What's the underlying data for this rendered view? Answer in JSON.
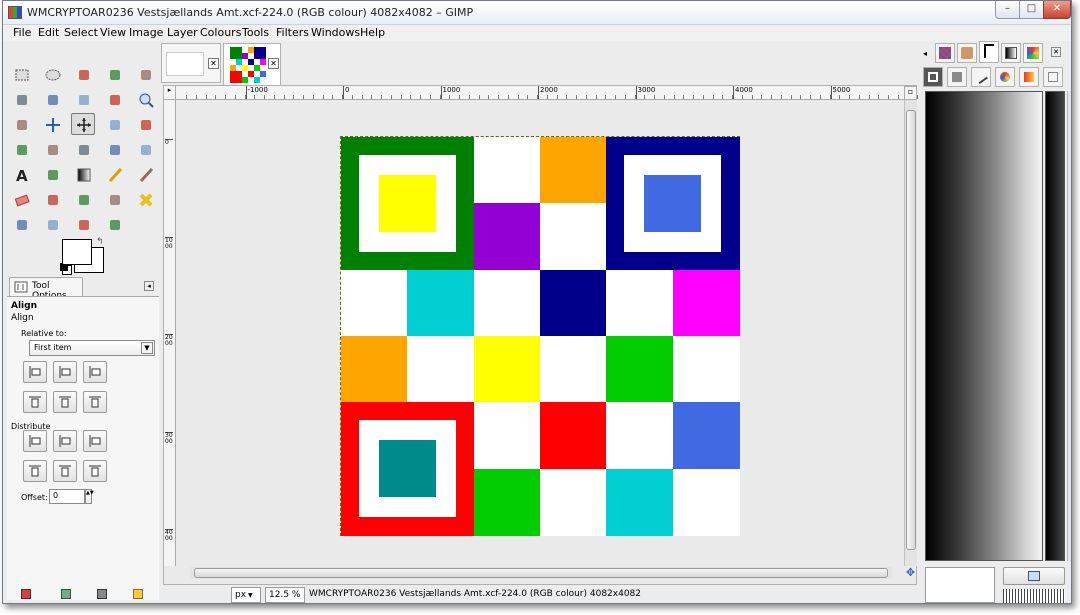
{
  "window": {
    "title": "WMCRYPTOAR0236 Vestsjællands Amt.xcf-224.0 (RGB colour) 4082x4082 – GIMP",
    "minimize": "–",
    "maximize": "□",
    "close": "✕"
  },
  "menubar": [
    "File",
    "Edit",
    "Select",
    "View",
    "Image",
    "Layer",
    "Colours",
    "Tools",
    "Filters",
    "Windows",
    "Help"
  ],
  "toolbox": {
    "tools": [
      "rect-select-icon",
      "ellipse-select-icon",
      "free-select-icon",
      "fuzzy-select-icon",
      "select-by-color-icon",
      "scissors-icon",
      "foreground-select-icon",
      "paths-icon",
      "color-picker-icon",
      "zoom-icon",
      "measure-icon",
      "move-icon",
      "align-icon",
      "crop-icon",
      "rotate-icon",
      "scale-icon",
      "shear-icon",
      "perspective-icon",
      "flip-icon",
      "cage-icon",
      "text-icon",
      "bucket-fill-icon",
      "blend-icon",
      "pencil-icon",
      "paintbrush-icon",
      "eraser-icon",
      "airbrush-icon",
      "ink-icon",
      "clone-icon",
      "heal-icon",
      "perspective-clone-icon",
      "blur-icon",
      "smudge-icon",
      "dodge-burn-icon"
    ],
    "active_tool": "align-icon",
    "foreground_color": "#ffffff",
    "background_color": "#ffffff"
  },
  "tool_options": {
    "tab_label": "Tool Options",
    "heading": "Align",
    "subheading": "Align",
    "relative_to_label": "Relative to:",
    "relative_to_value": "First item",
    "distribute_label": "Distribute",
    "offset_label": "Offset:",
    "offset_value": "0"
  },
  "ruler": {
    "h_labels": [
      "-1000",
      "0",
      "1000",
      "2000",
      "3000",
      "4000",
      "5000"
    ],
    "v_labels": [
      "0",
      "1000",
      "2000",
      "3000",
      "4000"
    ]
  },
  "image": {
    "grid": [
      [
        "#008000",
        "#008000",
        "#ffffff",
        "#ffa500",
        "#00008b",
        "#00008b"
      ],
      [
        "#008000",
        "#008000",
        "#9400d3",
        "#ffffff",
        "#00008b",
        "#00008b"
      ],
      [
        "#ffffff",
        "#00ced1",
        "#ffffff",
        "#00008b",
        "#ffffff",
        "#ff00ff"
      ],
      [
        "#ffa500",
        "#ffffff",
        "#ffff00",
        "#ffffff",
        "#00cc00",
        "#ffffff"
      ],
      [
        "#ff0000",
        "#ff0000",
        "#ffffff",
        "#ff0000",
        "#ffffff",
        "#4169e1"
      ],
      [
        "#ff0000",
        "#ff0000",
        "#00cc00",
        "#ffffff",
        "#00ced1",
        "#ffffff"
      ]
    ],
    "square_inner_colors": [
      "#ffff00",
      "#4169e1",
      "#008b8b"
    ]
  },
  "statusbar": {
    "unit": "px",
    "zoom": "12.5 %",
    "info": "WMCRYPTOAR0236 Vestsjællands Amt.xcf-224.0 (RGB colour) 4082x4082"
  }
}
